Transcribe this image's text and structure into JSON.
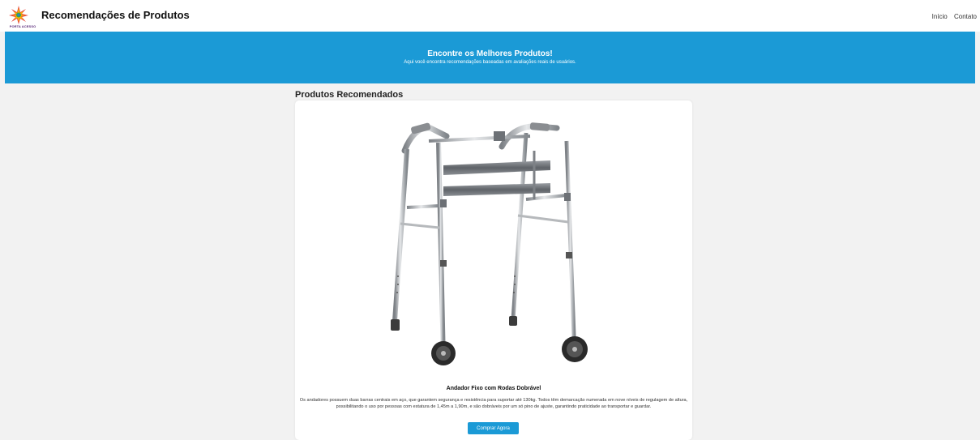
{
  "header": {
    "logo_text": "PORTA ACESSO",
    "title": "Recomendações de Produtos",
    "nav": [
      "Início",
      "Contato"
    ]
  },
  "hero": {
    "title": "Encontre os Melhores Produtos!",
    "subtitle": "Aqui você encontra recomendações baseadas em avaliações reais de usuários."
  },
  "section": {
    "title": "Produtos Recomendados"
  },
  "product": {
    "image_icon": "walker-image",
    "name": "Andador Fixo com Rodas Dobrável",
    "description": "Os andadores possuem duas barras centrais em aço, que garantem segurança e resistência para suportar até 130kg. Todos têm demarcação numerada em nove níveis de regulagem de altura, possibilitando o uso por pessoas com estatura de 1,45m a 1,90m, e são dobráveis por um só pino de ajuste, garantindo praticidade ao transportar e guardar.",
    "button_label": "Comprar Agora"
  },
  "colors": {
    "accent": "#1b9ad6",
    "page_bg": "#f2f2f2"
  }
}
